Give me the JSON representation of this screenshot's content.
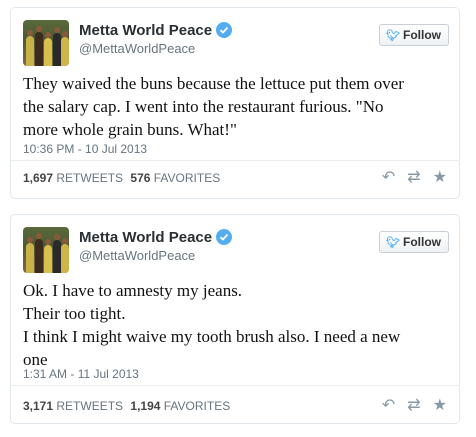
{
  "tweets": [
    {
      "name": "Metta World Peace",
      "handle": "@MettaWorldPeace",
      "follow_label": "Follow",
      "text_lines": [
        "They waived the buns because the lettuce put them over",
        "the salary cap. I went into the restaurant furious. \"No",
        "more whole grain buns. What!\""
      ],
      "timestamp": "10:36 PM - 10 Jul 2013",
      "retweets_count": "1,697",
      "retweets_label": "RETWEETS",
      "favorites_count": "576",
      "favorites_label": "FAVORITES"
    },
    {
      "name": "Metta World Peace",
      "handle": "@MettaWorldPeace",
      "follow_label": "Follow",
      "text_lines": [
        "Ok. I have to amnesty my jeans.",
        "Their too tight.",
        "I think I might waive my tooth brush also. I need a new",
        "one"
      ],
      "timestamp": "1:31 AM - 11 Jul 2013",
      "retweets_count": "3,171",
      "retweets_label": "RETWEETS",
      "favorites_count": "1,194",
      "favorites_label": "FAVORITES"
    }
  ],
  "icons": {
    "verified": "verified-badge-icon",
    "follow_bird": "twitter-bird-icon",
    "reply": "reply-icon",
    "retweet": "retweet-icon",
    "favorite": "star-icon"
  },
  "colors": {
    "verified_blue": "#55acee",
    "muted_text": "#66757f",
    "action_icons": "#8899a6"
  }
}
